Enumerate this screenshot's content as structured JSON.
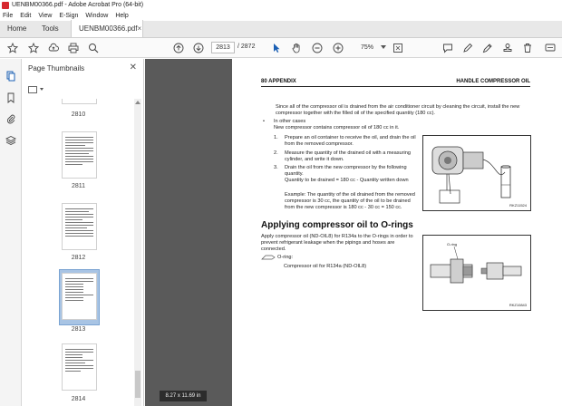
{
  "window": {
    "title": "UENBM00366.pdf - Adobe Acrobat Pro (64-bit)"
  },
  "menu": {
    "items": [
      "File",
      "Edit",
      "View",
      "E-Sign",
      "Window",
      "Help"
    ]
  },
  "tabs": {
    "home": "Home",
    "tools": "Tools",
    "document": "UENBM00366.pdf",
    "close": "×"
  },
  "toolbar": {
    "current_page": "2813",
    "total_pages": "/ 2872",
    "zoom": "75%"
  },
  "thumbnails": {
    "title": "Page Thumbnails",
    "close": "✕",
    "pages": [
      {
        "label": "2810"
      },
      {
        "label": "2811"
      },
      {
        "label": "2812"
      },
      {
        "label": "2813",
        "selected": true
      },
      {
        "label": "2814"
      }
    ]
  },
  "document": {
    "header_left": "80 APPENDIX",
    "header_right": "HANDLE COMPRESSOR OIL",
    "para1": "Since all of the compressor oil is drained from the air conditioner circuit by cleaning the circuit, install the new compressor together with the filled oil of the specified quantity (180 cc).",
    "bullet_title": "In other cases",
    "bullet_text": "New compressor contains compressor oil of 180 cc in it.",
    "step1": "Prepare an oil container to receive the oil, and drain the oil from the removed compressor.",
    "step2": "Measure the quantity of the drained oil with a measuring cylinder, and write it down.",
    "step3": "Drain the oil from the new compressor by the following quantity.",
    "step3b": "Quantity to be drained = 180 cc - Quantity written down",
    "example": "Example: The quantity of the oil drained from the removed compressor is 30 cc, the quantity of the oil to be drained from the new compressor is 180 cc - 30 cc = 150 cc.",
    "section_title": "Applying compressor oil to O-rings",
    "para2": "Apply compressor oil (ND-OIL8) for R134a to the O-rings in order to prevent refrigerant leakage when the pipings and hoses are connected.",
    "oring_label": "O-ring:",
    "oring_spec": "Compressor oil for R134a (ND-OIL8)",
    "fig1_code": "RKZ11524",
    "fig2_code": "RKZ10843",
    "fig2_label": "O-ring"
  },
  "status": {
    "page_size": "8.27 x 11.69 in"
  }
}
